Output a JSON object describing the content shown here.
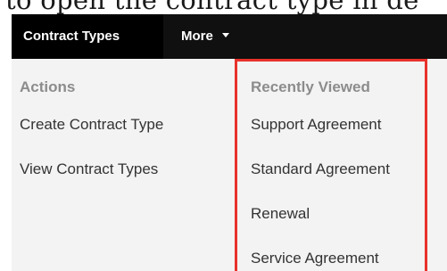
{
  "caption": {
    "text": "to open the contract type in de"
  },
  "navbar": {
    "active_tab": "Contract Types",
    "more_label": "More"
  },
  "menu": {
    "actions": {
      "header": "Actions",
      "items": [
        {
          "label": "Create Contract Type"
        },
        {
          "label": "View Contract Types"
        }
      ]
    },
    "recently_viewed": {
      "header": "Recently Viewed",
      "items": [
        {
          "label": "Support Agreement"
        },
        {
          "label": "Standard Agreement"
        },
        {
          "label": "Renewal"
        },
        {
          "label": "Service Agreement"
        }
      ]
    }
  },
  "colors": {
    "navbar_bg": "#101010",
    "active_tab_bg": "#000000",
    "panel_bg": "#f3f3f3",
    "highlight_border": "#e8322b",
    "header_text": "#8c8c8c",
    "item_text": "#333333"
  },
  "icons": {
    "more_caret": "caret-down-icon"
  }
}
